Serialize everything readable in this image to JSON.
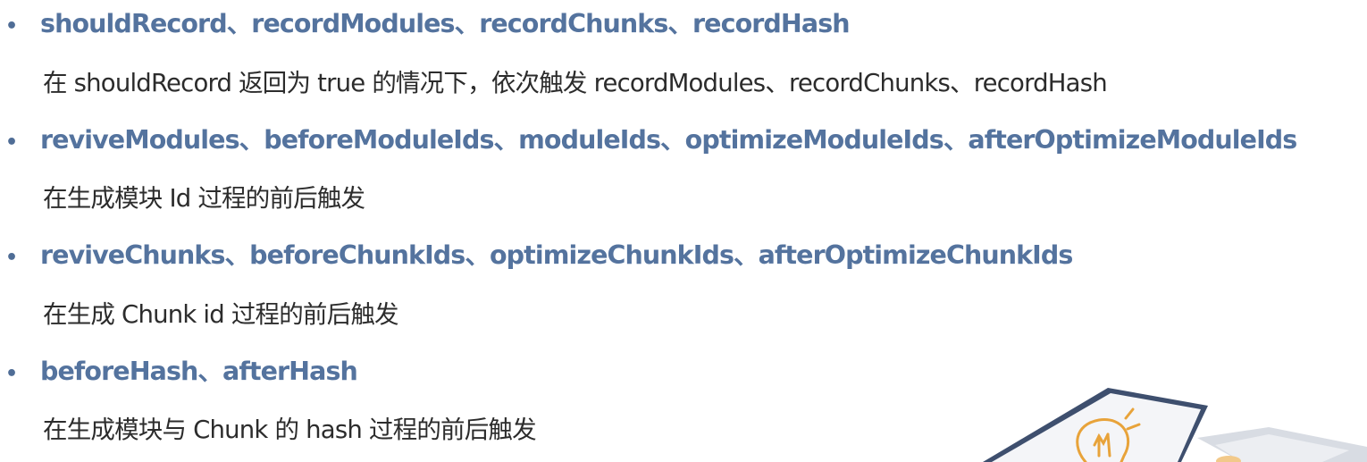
{
  "items": [
    {
      "heading": "shouldRecord、recordModules、recordChunks、recordHash",
      "description": "在 shouldRecord 返回为 true 的情况下，依次触发 recordModules、recordChunks、recordHash"
    },
    {
      "heading": "reviveModules、beforeModuleIds、moduleIds、optimizeModuleIds、afterOptimizeModuleIds",
      "description": "在生成模块 Id 过程的前后触发"
    },
    {
      "heading": "reviveChunks、beforeChunkIds、optimizeChunkIds、afterOptimizeChunkIds",
      "description": "在生成 Chunk id 过程的前后触发"
    },
    {
      "heading": "beforeHash、afterHash",
      "description": "在生成模块与 Chunk 的 hash 过程的前后触发"
    }
  ],
  "colors": {
    "heading": "#54739e",
    "bullet": "#4f6d96",
    "body_text": "#2c2c2c",
    "illustration_accent": "#e8a33a",
    "illustration_dark": "#3e4f6e"
  },
  "icons": {
    "illustration": "lightbulb-icon"
  }
}
